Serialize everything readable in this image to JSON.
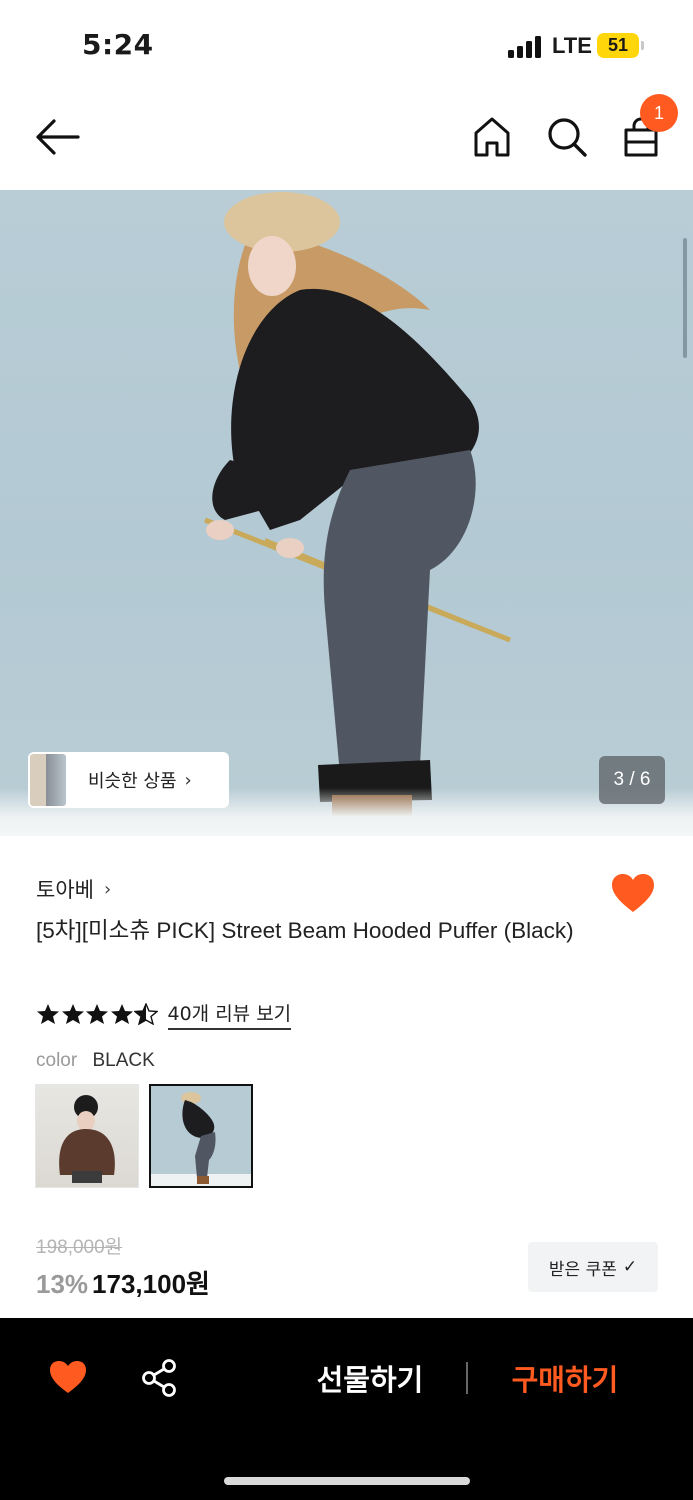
{
  "status_bar": {
    "time": "5:24",
    "network": "LTE",
    "battery": "51"
  },
  "header": {
    "cart_count": "1"
  },
  "gallery": {
    "similar_label": "비슷한 상품",
    "counter": "3 / 6"
  },
  "product": {
    "brand": "토아베",
    "title": "[5차][미소츄 PICK] Street Beam Hooded Puffer (Black)",
    "rating": 4.5,
    "review_link": "40개 리뷰 보기",
    "color_label": "color",
    "color_value": "BLACK",
    "original_price": "198,000원",
    "discount": "13%",
    "price": "173,100원",
    "coupon_label": "받은 쿠폰",
    "favorited": true
  },
  "bottom_bar": {
    "gift_label": "선물하기",
    "buy_label": "구매하기"
  },
  "colors": {
    "accent": "#ff5a1f",
    "battery": "#ffd60a",
    "bottom_bar_bg": "#000000"
  }
}
